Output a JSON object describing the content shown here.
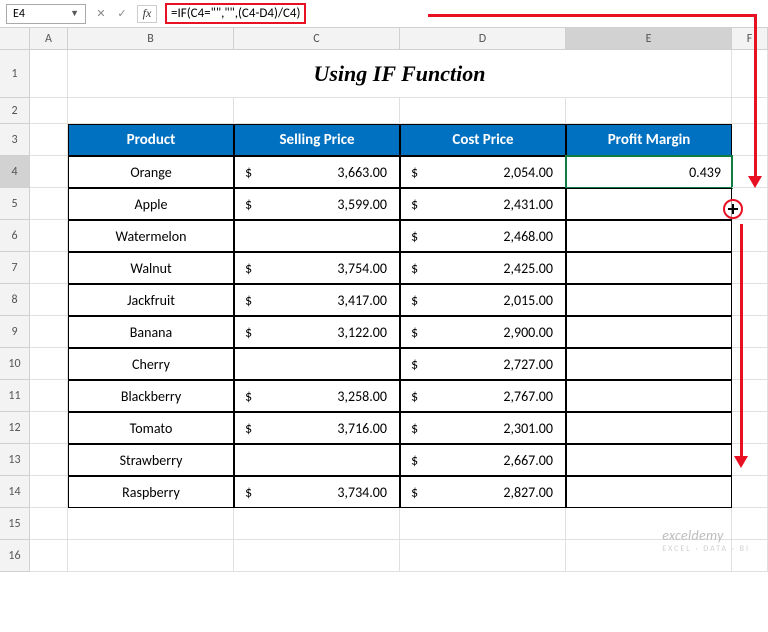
{
  "name_box": "E4",
  "formula": "=IF(C4=\"\",\"\",(C4-D4)/C4)",
  "fx_label": "fx",
  "cancel_label": "✕",
  "check_label": "✓",
  "title": "Using IF Function",
  "columns": [
    "A",
    "B",
    "C",
    "D",
    "E",
    "F"
  ],
  "headers": {
    "product": "Product",
    "sell": "Selling Price",
    "cost": "Cost Price",
    "margin": "Profit Margin"
  },
  "rows": [
    {
      "n": "4",
      "product": "Orange",
      "sell": "3,663.00",
      "cost": "2,054.00",
      "margin": "0.439"
    },
    {
      "n": "5",
      "product": "Apple",
      "sell": "3,599.00",
      "cost": "2,431.00",
      "margin": ""
    },
    {
      "n": "6",
      "product": "Watermelon",
      "sell": "",
      "cost": "2,468.00",
      "margin": ""
    },
    {
      "n": "7",
      "product": "Walnut",
      "sell": "3,754.00",
      "cost": "2,425.00",
      "margin": ""
    },
    {
      "n": "8",
      "product": "Jackfruit",
      "sell": "3,417.00",
      "cost": "2,015.00",
      "margin": ""
    },
    {
      "n": "9",
      "product": "Banana",
      "sell": "3,122.00",
      "cost": "2,900.00",
      "margin": ""
    },
    {
      "n": "10",
      "product": "Cherry",
      "sell": "",
      "cost": "2,727.00",
      "margin": ""
    },
    {
      "n": "11",
      "product": "Blackberry",
      "sell": "3,258.00",
      "cost": "2,767.00",
      "margin": ""
    },
    {
      "n": "12",
      "product": "Tomato",
      "sell": "3,716.00",
      "cost": "2,301.00",
      "margin": ""
    },
    {
      "n": "13",
      "product": "Strawberry",
      "sell": "",
      "cost": "2,667.00",
      "margin": ""
    },
    {
      "n": "14",
      "product": "Raspberry",
      "sell": "3,734.00",
      "cost": "2,827.00",
      "margin": ""
    }
  ],
  "dollar": "$",
  "watermark": "exceldemy",
  "watermark_sub": "EXCEL · DATA · BI"
}
